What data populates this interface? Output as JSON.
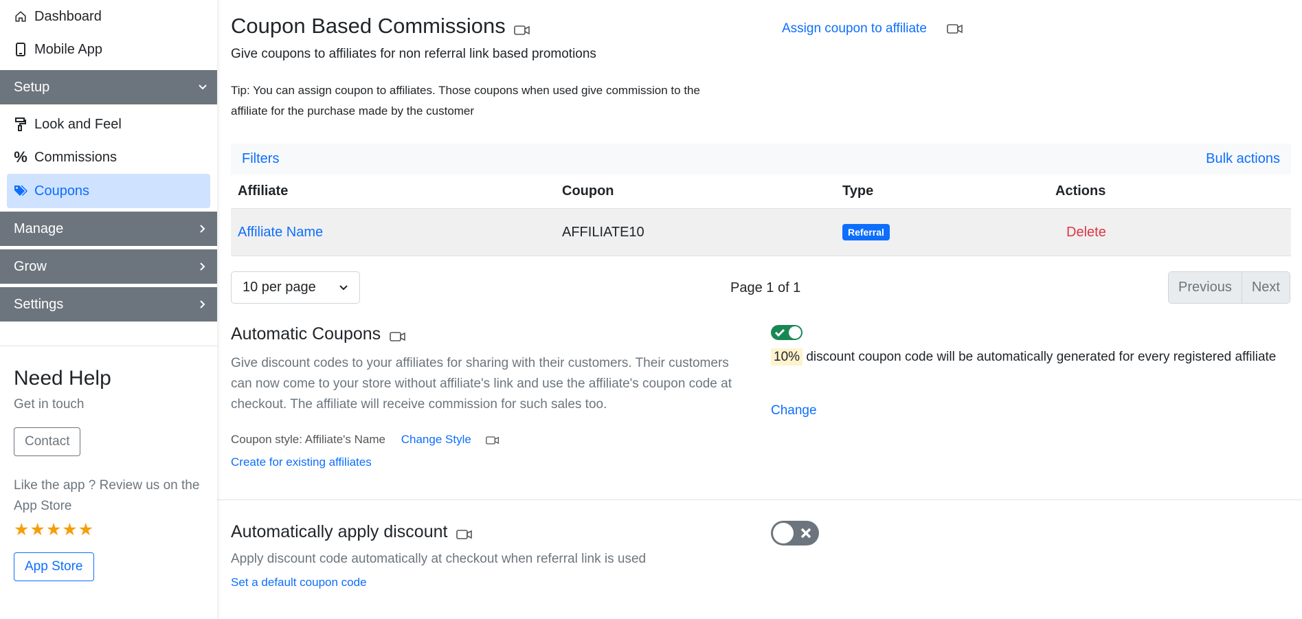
{
  "sidebar": {
    "top_items": [
      {
        "label": "Dashboard",
        "icon": "home-icon"
      },
      {
        "label": "Mobile App",
        "icon": "mobile-icon"
      }
    ],
    "sections": {
      "setup": "Setup",
      "manage": "Manage",
      "grow": "Grow",
      "settings": "Settings"
    },
    "setup_items": [
      {
        "label": "Look and Feel",
        "icon": "paint-roller-icon"
      },
      {
        "label": "Commissions",
        "icon": "percent-icon"
      },
      {
        "label": "Coupons",
        "icon": "tags-icon"
      }
    ],
    "help": {
      "title": "Need Help",
      "subtitle": "Get in touch",
      "contact_label": "Contact",
      "review_text": "Like the app ? Review us on the App Store",
      "stars": "★★★★★",
      "appstore_label": "App Store"
    }
  },
  "header": {
    "title": "Coupon Based Commissions",
    "subtitle": "Give coupons to affiliates for non referral link based promotions",
    "tip": "Tip: You can assign coupon to affiliates. Those coupons when used give commission to the affiliate for the purchase made by the customer",
    "assign_link": "Assign coupon to affiliate"
  },
  "table": {
    "filters_label": "Filters",
    "bulk_label": "Bulk actions",
    "columns": [
      "Affiliate",
      "Coupon",
      "Type",
      "Actions"
    ],
    "rows": [
      {
        "affiliate": "Affiliate Name",
        "coupon": "AFFILIATE10",
        "type": "Referral",
        "action": "Delete"
      }
    ]
  },
  "pagination": {
    "per_page": "10 per page",
    "page_text": "Page 1 of 1",
    "prev_label": "Previous",
    "next_label": "Next"
  },
  "automatic_coupons": {
    "title": "Automatic Coupons",
    "description": "Give discount codes to your affiliates for sharing with their customers. Their customers can now come to your store without affiliate's link and use the affiliate's coupon code at checkout. The affiliate will receive commission for such sales too.",
    "style_text": "Coupon style: Affiliate's Name",
    "change_style_label": "Change Style",
    "create_existing_label": "Create for existing affiliates",
    "enabled": true,
    "discount": "10%",
    "discount_text": "discount coupon code will be automatically generated for every registered affiliate",
    "change_label": "Change"
  },
  "auto_apply": {
    "title": "Automatically apply discount",
    "description": "Apply discount code automatically at checkout when referral link is used",
    "default_code_label": "Set a default coupon code",
    "enabled": false
  },
  "colors": {
    "accent": "#0d6efd",
    "sidebar_section": "#6c757d",
    "active_item_bg": "#cfe2ff",
    "danger": "#dc3545",
    "toggle_on": "#198754",
    "toggle_off": "#6c757d",
    "star": "#f59e0b"
  }
}
